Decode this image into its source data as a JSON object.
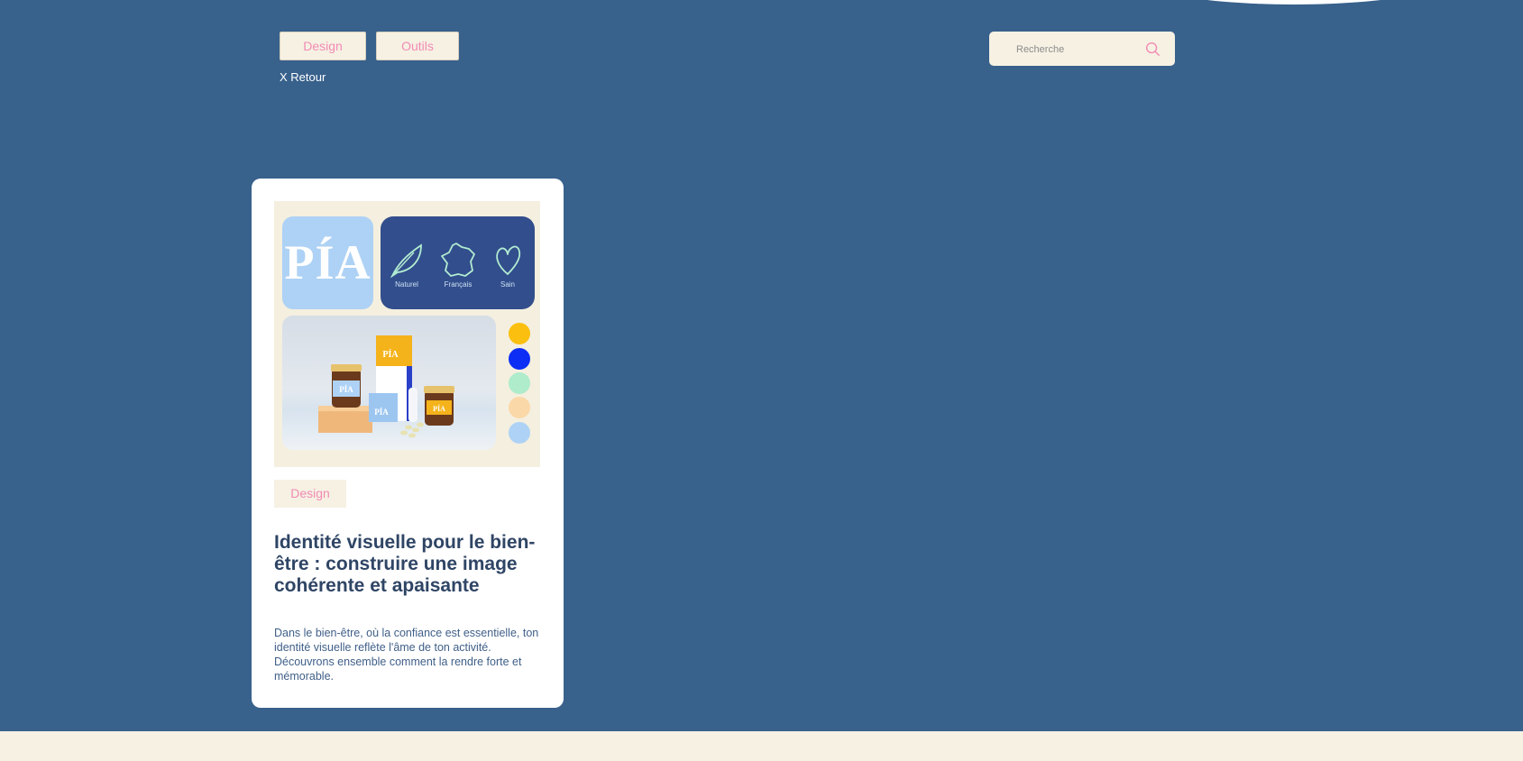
{
  "nav": {
    "filters": [
      {
        "label": "Design"
      },
      {
        "label": "Outils"
      }
    ],
    "back_label": "X Retour"
  },
  "search": {
    "placeholder": "Recherche",
    "value": "",
    "icon": "search-icon"
  },
  "colors": {
    "background": "#38618c",
    "accent_pink": "#f28bb5",
    "cream": "#f6f1e3",
    "title": "#2f4565"
  },
  "card": {
    "image": {
      "logo_text": "PÍA",
      "values": [
        {
          "label": "Naturel",
          "icon": "leaf-icon"
        },
        {
          "label": "Français",
          "icon": "france-map-icon"
        },
        {
          "label": "Sain",
          "icon": "heart-icon"
        }
      ],
      "palette": [
        "#fbbf0f",
        "#0d2ef5",
        "#aeeccb",
        "#fbd8a8",
        "#aed2f5"
      ],
      "photo": {
        "product_label": "PÍA"
      }
    },
    "tag": "Design",
    "title": "Identité visuelle pour le bien-être : construire une image cohérente et apaisante",
    "excerpt": "Dans le bien-être, où la confiance est essentielle, ton identité visuelle reflète l'âme de ton activité. Découvrons ensemble comment la rendre forte et mémorable."
  }
}
